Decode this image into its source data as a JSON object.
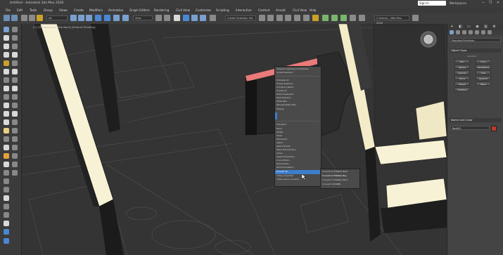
{
  "app": {
    "title": "Untitled - Autodesk 3ds Max 2020",
    "sign_in": "Sign In",
    "workspaces": "Workspaces",
    "window_controls": [
      "—",
      "❐",
      "✕"
    ]
  },
  "menu": [
    "File",
    "Edit",
    "Tools",
    "Group",
    "Views",
    "Create",
    "Modifiers",
    "Animation",
    "Graph Editors",
    "Rendering",
    "Civil View",
    "Customize",
    "Scripting",
    "Interactive",
    "Content",
    "Arnold",
    "Civil View",
    "Help"
  ],
  "toolbar": {
    "filter_dropdown": "All",
    "view_dropdown": "View",
    "selection_set": "Create Selection Set",
    "path_dropdown": "C:\\Users\\...\\3ds Max 2020"
  },
  "viewport": {
    "label": "[+] [Perspective] [Standard] [Default Shading]"
  },
  "context_menu": {
    "items": [
      "Viewport Lighting and Shadows",
      "Isolate Selection",
      "Unfreeze All",
      "Freeze Selection",
      "Unhide by Name",
      "Unhide All",
      "Hide Unselected",
      "Hide Selection",
      "State Sets",
      "Manage State Sets...",
      "Display",
      "Transform",
      "Move",
      "Rotate",
      "Scale",
      "Placement",
      "Select",
      "Select Similar",
      "Place Pivot Surface",
      "Clone",
      "Object Properties...",
      "Curve Editor...",
      "Dope Sheet...",
      "Wire Parameters...",
      "Convert To:",
      "V-Ray properties",
      "V-Ray scene converter"
    ],
    "submenu": [
      "Convert to Editable Mesh",
      "Convert to Editable Poly",
      "Convert to Editable Patch",
      "Convert to NURBS"
    ],
    "submenu_highlight": "Convert to Editable Poly",
    "highlight_color": "#3c7ecb"
  },
  "command_panel": {
    "tab_icons": [
      "+",
      "◧",
      "▭",
      "◉",
      "▥",
      "⚙"
    ],
    "category_dropdown": "Standard Primitives",
    "object_type_header": "Object Type",
    "autogrid_label": "AutoGrid",
    "buttons": [
      "Box",
      "Cone",
      "Sphere",
      "GeoSphere",
      "Cylinder",
      "Tube",
      "Torus",
      "Pyramid",
      "Teapot",
      "Plane",
      "TextPlus"
    ],
    "name_color_header": "Name and Color",
    "name_value": "Box001",
    "object_color": "#c0392b"
  }
}
